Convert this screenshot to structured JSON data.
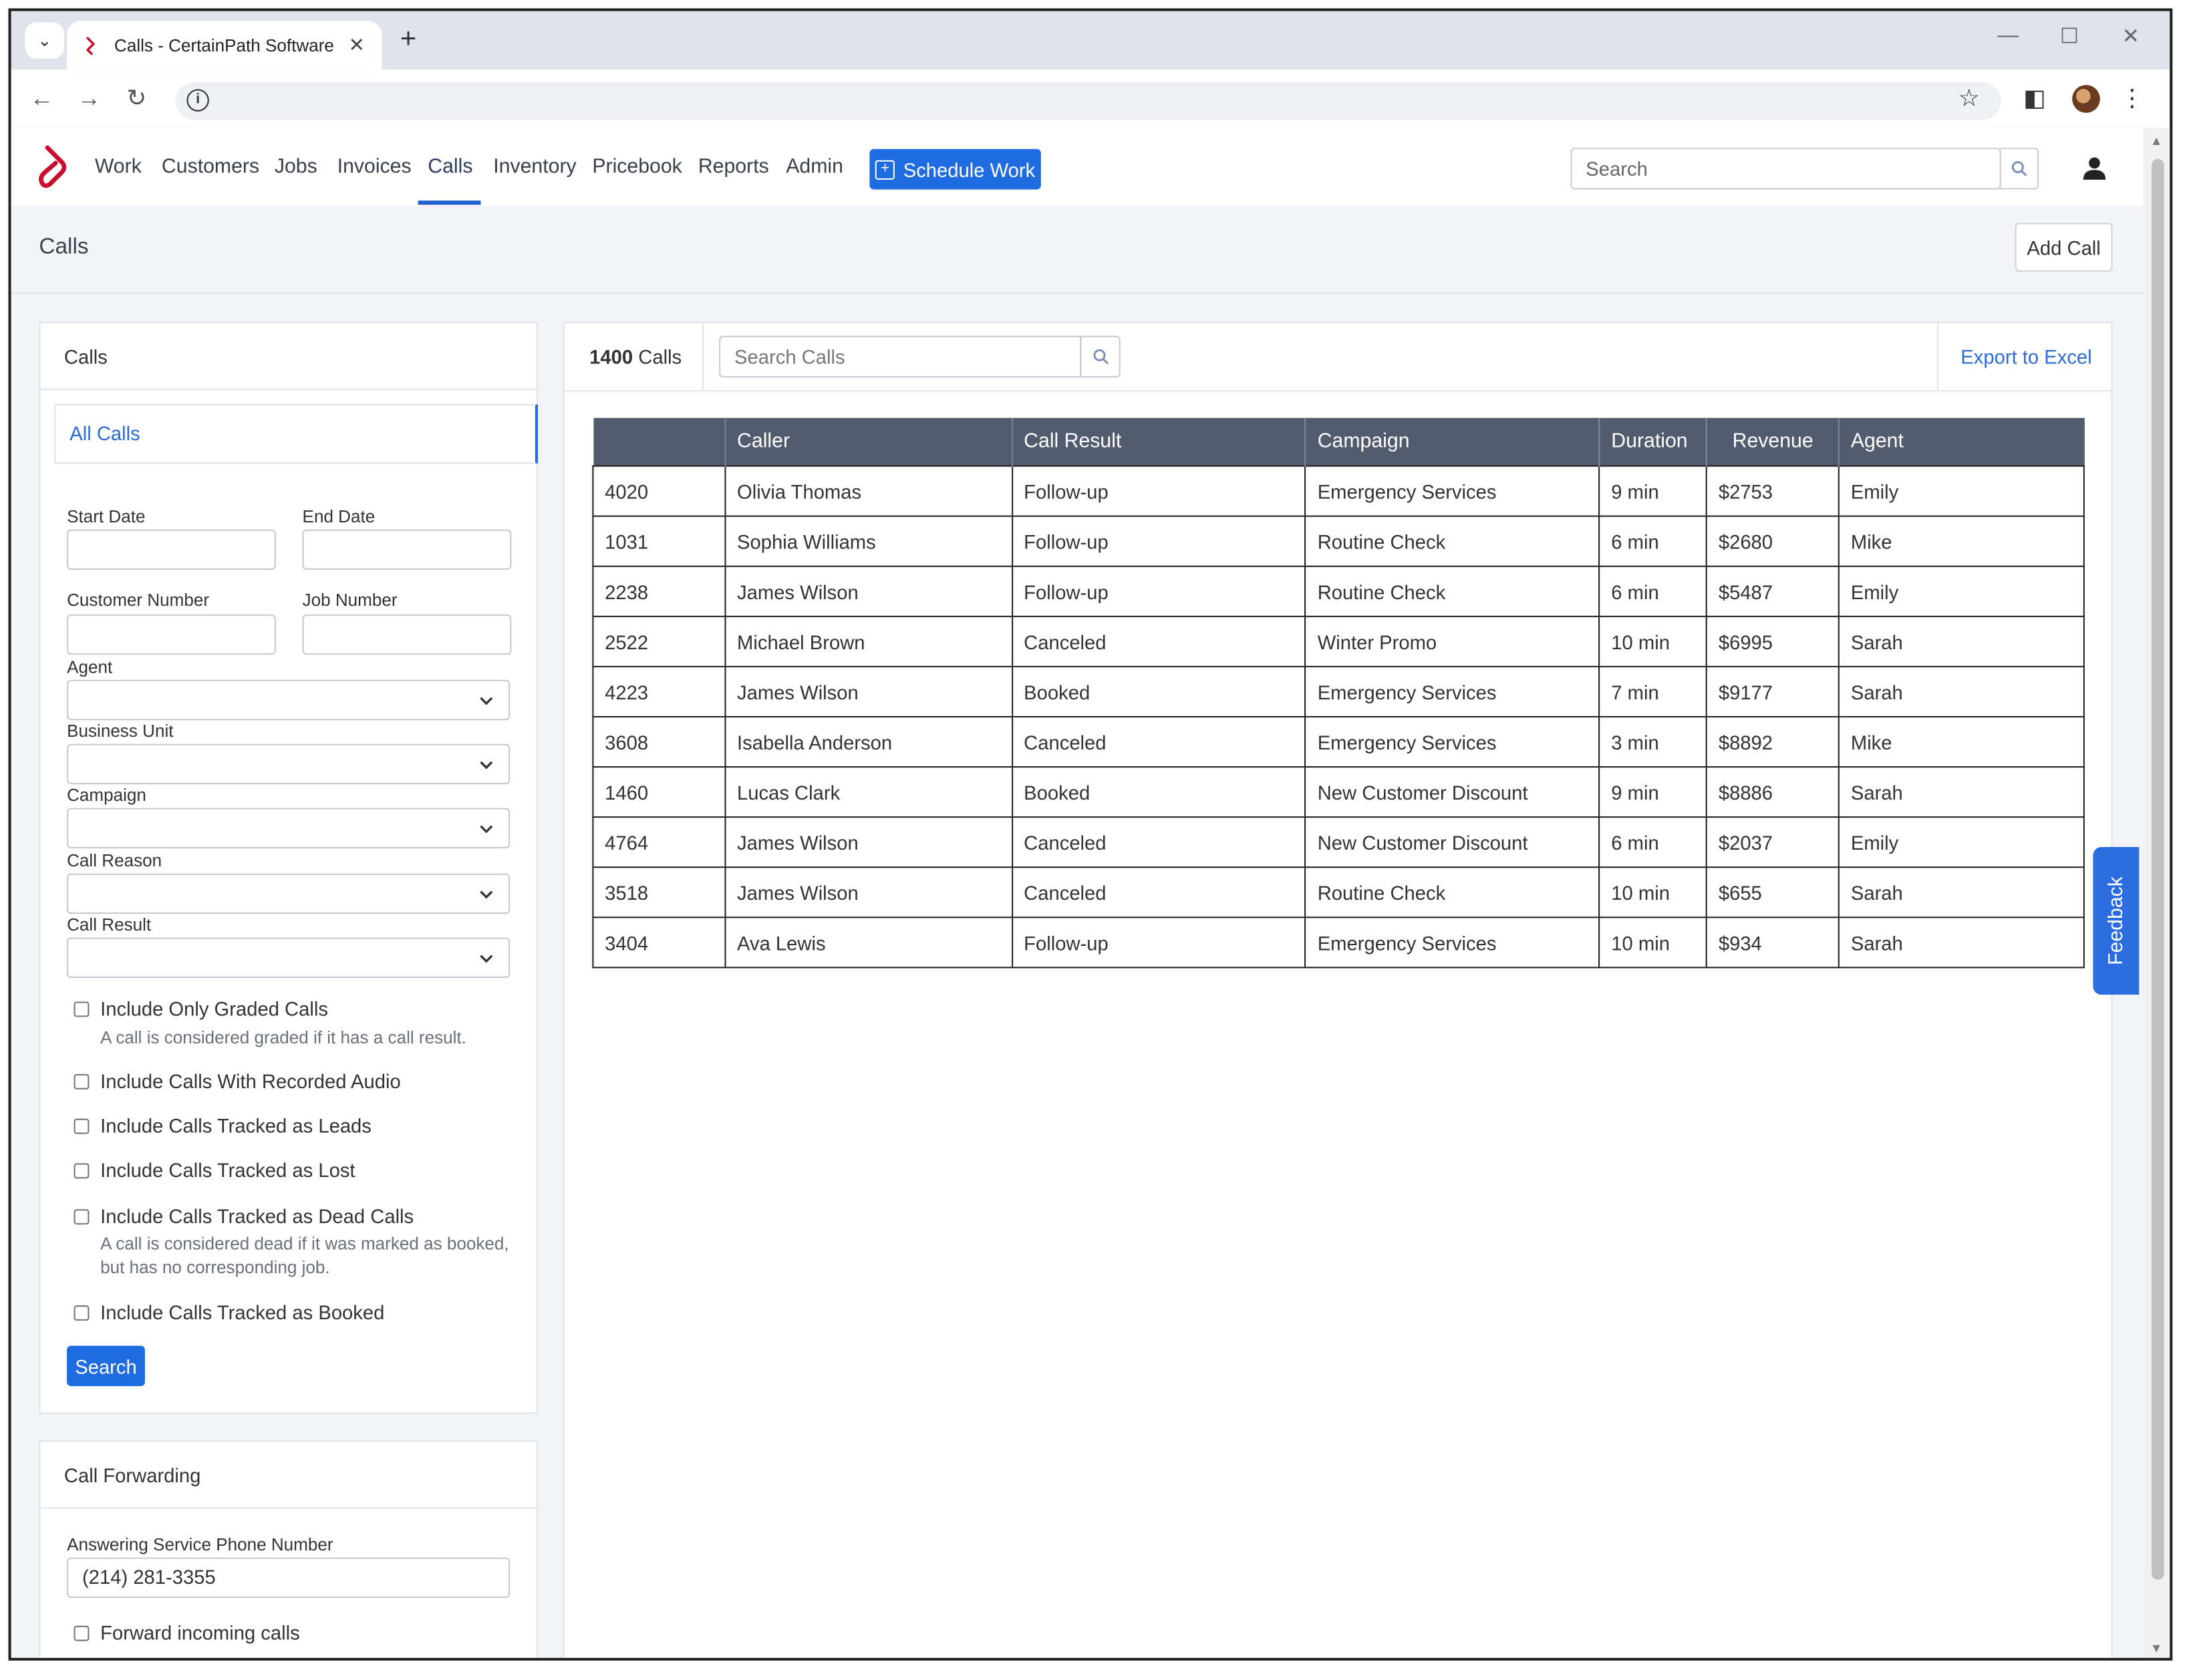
{
  "browser": {
    "tab_title": "Calls - CertainPath Software",
    "tab_close": "✕",
    "new_tab": "+",
    "minimize": "—",
    "maximize": "☐",
    "close": "✕"
  },
  "appnav": {
    "items": [
      {
        "label": "Work"
      },
      {
        "label": "Customers"
      },
      {
        "label": "Jobs"
      },
      {
        "label": "Invoices"
      },
      {
        "label": "Calls"
      },
      {
        "label": "Inventory"
      },
      {
        "label": "Pricebook"
      },
      {
        "label": "Reports"
      },
      {
        "label": "Admin"
      }
    ],
    "active": "Calls",
    "schedule_label": "Schedule Work",
    "search_placeholder": "Search"
  },
  "page": {
    "title": "Calls",
    "add_call_label": "Add Call"
  },
  "filters": {
    "card_title": "Calls",
    "all_calls": "All Calls",
    "start_date_label": "Start Date",
    "end_date_label": "End Date",
    "customer_number_label": "Customer Number",
    "job_number_label": "Job Number",
    "agent_label": "Agent",
    "business_unit_label": "Business Unit",
    "campaign_label": "Campaign",
    "call_reason_label": "Call Reason",
    "call_result_label": "Call Result",
    "checkboxes": [
      {
        "label": "Include Only Graded Calls",
        "hint": "A call is considered graded if it has a call result."
      },
      {
        "label": "Include Calls With Recorded Audio"
      },
      {
        "label": "Include Calls Tracked as Leads"
      },
      {
        "label": "Include Calls Tracked as Lost"
      },
      {
        "label": "Include Calls Tracked as Dead Calls",
        "hint_line1": "A call is considered dead if it was marked as booked,",
        "hint_line2": "but has no corresponding job."
      },
      {
        "label": "Include Calls Tracked as Booked"
      }
    ],
    "search_label": "Search"
  },
  "forwarding": {
    "card_title": "Call Forwarding",
    "phone_label": "Answering Service Phone Number",
    "phone_value": "(214) 281-3355",
    "forward_label": "Forward incoming calls"
  },
  "calls": {
    "count": "1400",
    "count_suffix": "Calls",
    "search_placeholder": "Search Calls",
    "export_label": "Export to Excel",
    "columns": [
      "",
      "Caller",
      "Call Result",
      "Campaign",
      "Duration",
      "Revenue",
      "Agent"
    ],
    "rows": [
      {
        "id": "4020",
        "caller": "Olivia Thomas",
        "result": "Follow-up",
        "campaign": "Emergency Services",
        "duration": "9 min",
        "revenue": "$2753",
        "agent": "Emily"
      },
      {
        "id": "1031",
        "caller": "Sophia Williams",
        "result": "Follow-up",
        "campaign": "Routine Check",
        "duration": "6 min",
        "revenue": "$2680",
        "agent": "Mike"
      },
      {
        "id": "2238",
        "caller": "James Wilson",
        "result": "Follow-up",
        "campaign": "Routine Check",
        "duration": "6 min",
        "revenue": "$5487",
        "agent": "Emily"
      },
      {
        "id": "2522",
        "caller": "Michael Brown",
        "result": "Canceled",
        "campaign": "Winter Promo",
        "duration": "10 min",
        "revenue": "$6995",
        "agent": "Sarah"
      },
      {
        "id": "4223",
        "caller": "James Wilson",
        "result": "Booked",
        "campaign": "Emergency Services",
        "duration": "7 min",
        "revenue": "$9177",
        "agent": "Sarah"
      },
      {
        "id": "3608",
        "caller": "Isabella Anderson",
        "result": "Canceled",
        "campaign": "Emergency Services",
        "duration": "3 min",
        "revenue": "$8892",
        "agent": "Mike"
      },
      {
        "id": "1460",
        "caller": "Lucas Clark",
        "result": "Booked",
        "campaign": "New Customer Discount",
        "duration": "9 min",
        "revenue": "$8886",
        "agent": "Sarah"
      },
      {
        "id": "4764",
        "caller": "James Wilson",
        "result": "Canceled",
        "campaign": "New Customer Discount",
        "duration": "6 min",
        "revenue": "$2037",
        "agent": "Emily"
      },
      {
        "id": "3518",
        "caller": "James Wilson",
        "result": "Canceled",
        "campaign": "Routine Check",
        "duration": "10 min",
        "revenue": "$655",
        "agent": "Sarah"
      },
      {
        "id": "3404",
        "caller": "Ava Lewis",
        "result": "Follow-up",
        "campaign": "Emergency Services",
        "duration": "10 min",
        "revenue": "$934",
        "agent": "Sarah"
      }
    ]
  },
  "feedback_label": "Feedback",
  "colors": {
    "accent": "#1f6be0",
    "brand": "#c8102e",
    "table_header": "#525c6e",
    "link": "#2d6bd6"
  }
}
